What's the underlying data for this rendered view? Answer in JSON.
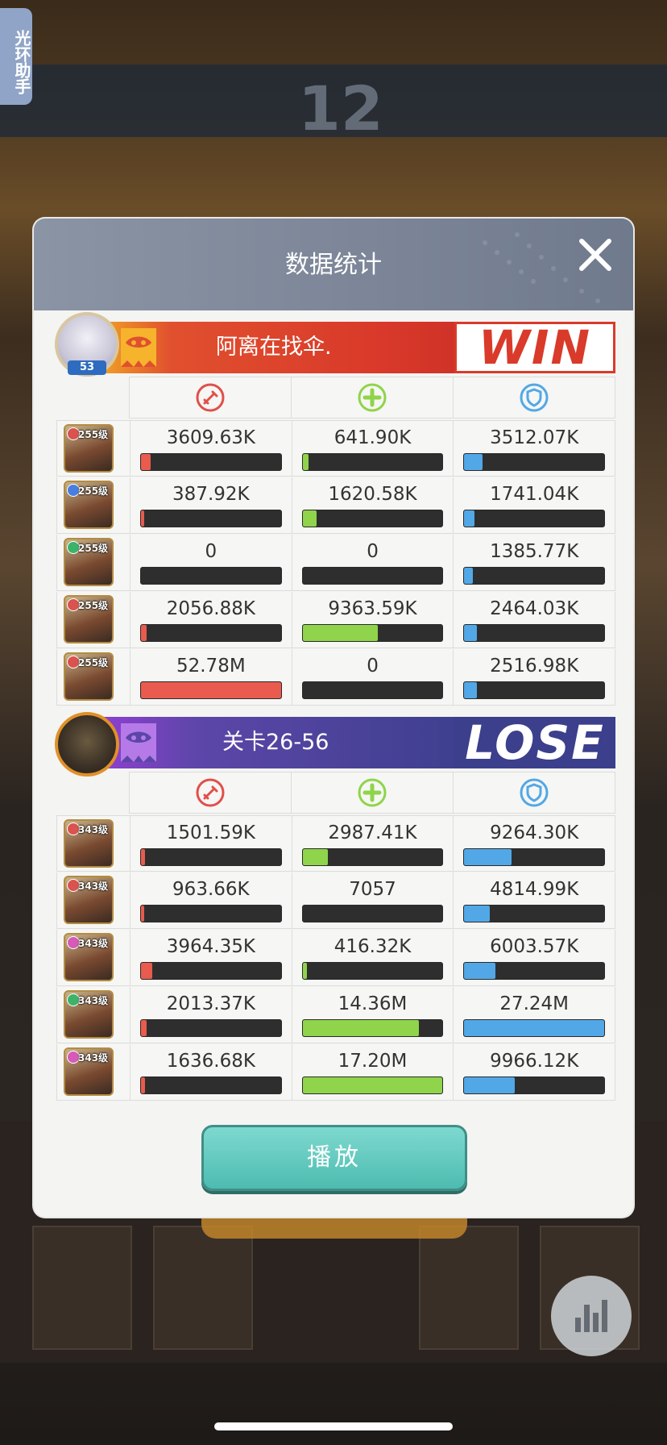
{
  "helper": {
    "label": "光环助手"
  },
  "dialog": {
    "title": "数据统计",
    "play_label": "播放"
  },
  "colors": {
    "damage": "#e85b4e",
    "heal": "#8fd44a",
    "defense": "#52a8e6",
    "win_red": "#d93a2a",
    "lose_purple": "#3b3f8c"
  },
  "stat_icons": [
    "sword-icon",
    "plus-icon",
    "shield-icon"
  ],
  "teams": [
    {
      "name": "阿离在找伞.",
      "result": "WIN",
      "player_level": "53",
      "heroes": [
        {
          "level": "255级",
          "element": "#d9534f",
          "values": [
            "3609.63K",
            "641.90K",
            "3512.07K"
          ],
          "fills": [
            0.07,
            0.04,
            0.13
          ]
        },
        {
          "level": "255级",
          "element": "#4a7de0",
          "values": [
            "387.92K",
            "1620.58K",
            "1741.04K"
          ],
          "fills": [
            0.01,
            0.1,
            0.07
          ]
        },
        {
          "level": "255级",
          "element": "#3db36a",
          "values": [
            "0",
            "0",
            "1385.77K"
          ],
          "fills": [
            0,
            0,
            0.06
          ]
        },
        {
          "level": "255级",
          "element": "#d9534f",
          "values": [
            "2056.88K",
            "9363.59K",
            "2464.03K"
          ],
          "fills": [
            0.04,
            0.54,
            0.09
          ]
        },
        {
          "level": "255级",
          "element": "#d9534f",
          "values": [
            "52.78M",
            "0",
            "2516.98K"
          ],
          "fills": [
            1.0,
            0,
            0.09
          ]
        }
      ]
    },
    {
      "name": "关卡26-56",
      "result": "LOSE",
      "heroes": [
        {
          "level": "343级",
          "element": "#d9534f",
          "values": [
            "1501.59K",
            "2987.41K",
            "9264.30K"
          ],
          "fills": [
            0.03,
            0.18,
            0.34
          ]
        },
        {
          "level": "343级",
          "element": "#d9534f",
          "values": [
            "963.66K",
            "7057",
            "4814.99K"
          ],
          "fills": [
            0.02,
            0.0,
            0.18
          ]
        },
        {
          "level": "343级",
          "element": "#d65ab8",
          "values": [
            "3964.35K",
            "416.32K",
            "6003.57K"
          ],
          "fills": [
            0.08,
            0.03,
            0.22
          ]
        },
        {
          "level": "343级",
          "element": "#3db36a",
          "values": [
            "2013.37K",
            "14.36M",
            "27.24M"
          ],
          "fills": [
            0.04,
            0.83,
            1.0
          ]
        },
        {
          "level": "343级",
          "element": "#d65ab8",
          "values": [
            "1636.68K",
            "17.20M",
            "9966.12K"
          ],
          "fills": [
            0.03,
            1.0,
            0.36
          ]
        }
      ]
    }
  ]
}
